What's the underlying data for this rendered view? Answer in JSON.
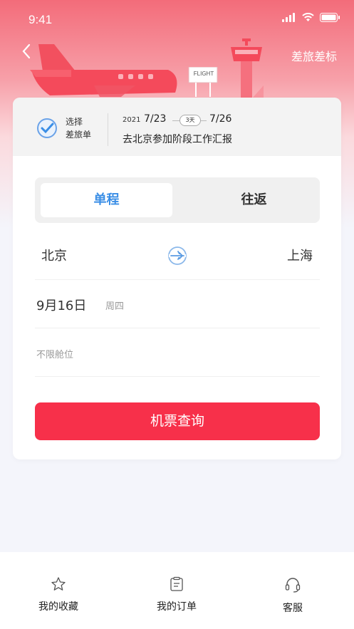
{
  "status": {
    "time": "9:41"
  },
  "header": {
    "right_link": "差旅差标",
    "flight_sign": "FLIGHT"
  },
  "trip": {
    "select_line1": "选择",
    "select_line2": "差旅单",
    "year": "2021",
    "start_date": "7/23",
    "duration": "3天",
    "end_date": "7/26",
    "title": "去北京参加阶段工作汇报"
  },
  "segmented": {
    "one_way": "单程",
    "round_trip": "往返",
    "selected": "one_way"
  },
  "route": {
    "from": "北京",
    "to": "上海"
  },
  "date": {
    "value": "9月16日",
    "weekday": "周四"
  },
  "cabin": {
    "value": "不限舱位"
  },
  "search": {
    "label": "机票查询"
  },
  "tabs": [
    {
      "label": "我的收藏",
      "icon": "star-icon"
    },
    {
      "label": "我的订单",
      "icon": "order-icon"
    },
    {
      "label": "客服",
      "icon": "headset-icon"
    }
  ],
  "colors": {
    "accent": "#f7304a",
    "selected_tab": "#3a8ee6",
    "hero": "#f36c7a"
  }
}
